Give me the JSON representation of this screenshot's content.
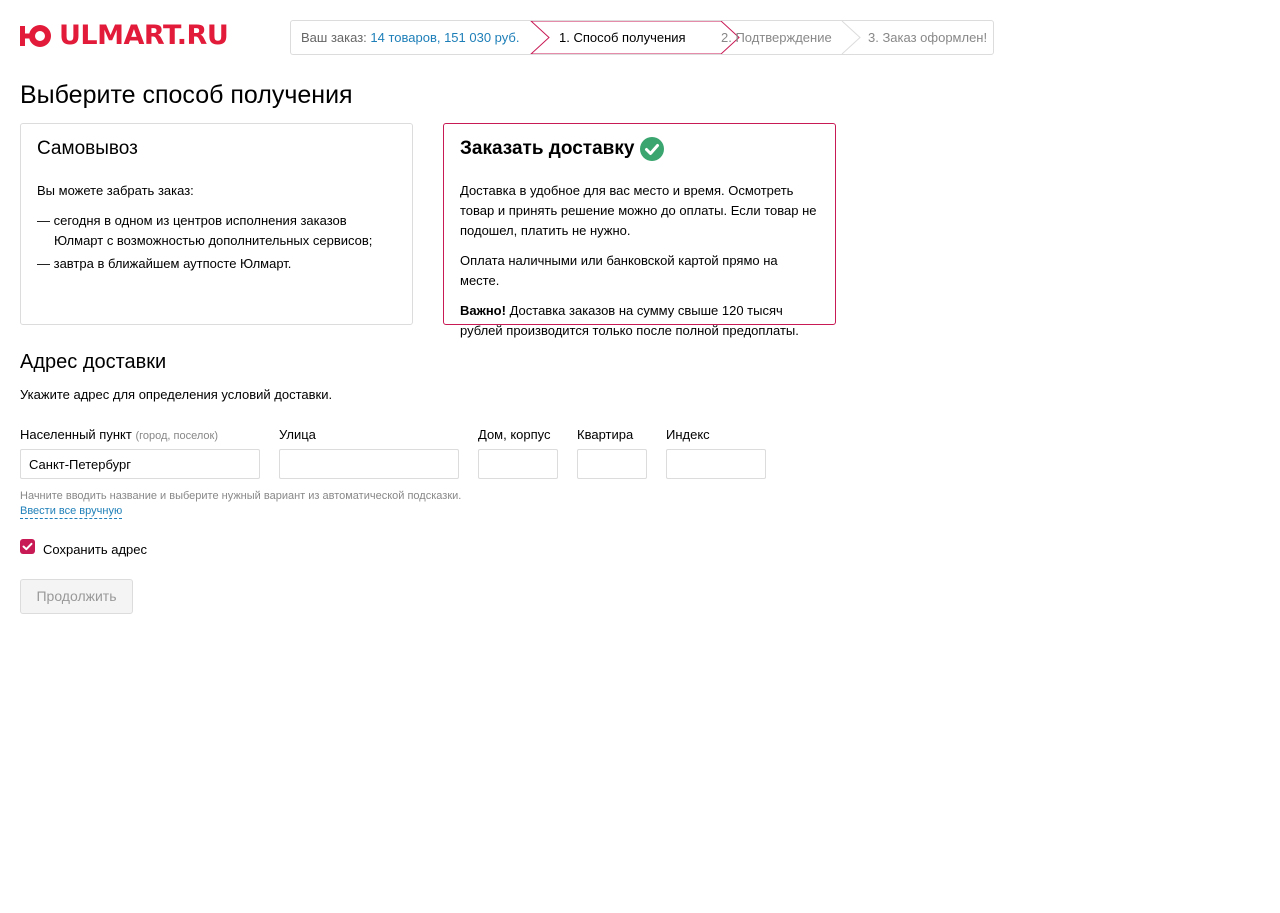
{
  "header": {
    "logo_text": "ULMART.RU",
    "logo_icon": "ulmart-logo-icon",
    "brand_color": "#e31b3a"
  },
  "steps": {
    "summary_prefix": "Ваш заказ:",
    "summary_link": "14 товаров, 151 030 руб.",
    "items": [
      {
        "label": "1. Способ получения",
        "active": true
      },
      {
        "label": "2. Подтверждение",
        "active": false
      },
      {
        "label": "3. Заказ оформлен!",
        "active": false
      }
    ]
  },
  "page_title": "Выберите способ получения",
  "pickup": {
    "title": "Самовывоз",
    "intro": "Вы можете забрать заказ:",
    "line1_a": "— сегодня в одном из центров исполнения заказов",
    "line1_b": "Юлмарт с возможностью дополнительных сервисов;",
    "line2": "— завтра в ближайшем аутпосте Юлмарт.",
    "selected": false
  },
  "delivery": {
    "title": "Заказать доставку",
    "selected": true,
    "check_icon": "check-circle-icon",
    "accent_color": "#c81a55",
    "check_color": "#3aa56f",
    "para1": "Доставка в удобное для вас место и время. Осмотреть товар и принять решение можно до оплаты. Если товар не подошел, платить не нужно.",
    "para2": "Оплата наличными или банковской картой прямо на месте.",
    "important_label": "Важно!",
    "para3": " Доставка заказов на сумму свыше 120 тысяч рублей производится только после полной предоплаты."
  },
  "address": {
    "title": "Адрес доставки",
    "description": "Укажите адрес для определения условий доставки.",
    "fields": {
      "city": {
        "label": "Населенный пункт",
        "hint": "(город, поселок)",
        "value": "Санкт-Петербург"
      },
      "street": {
        "label": "Улица",
        "value": ""
      },
      "house": {
        "label": "Дом, корпус",
        "value": ""
      },
      "apartment": {
        "label": "Квартира",
        "value": ""
      },
      "index": {
        "label": "Индекс",
        "value": ""
      }
    },
    "help_text": "Начните вводить название и выберите нужный вариант из автоматической подсказки.",
    "manual_link": "Ввести все вручную",
    "save_label": "Сохранить адрес",
    "save_checked": true
  },
  "continue_label": "Продолжить"
}
